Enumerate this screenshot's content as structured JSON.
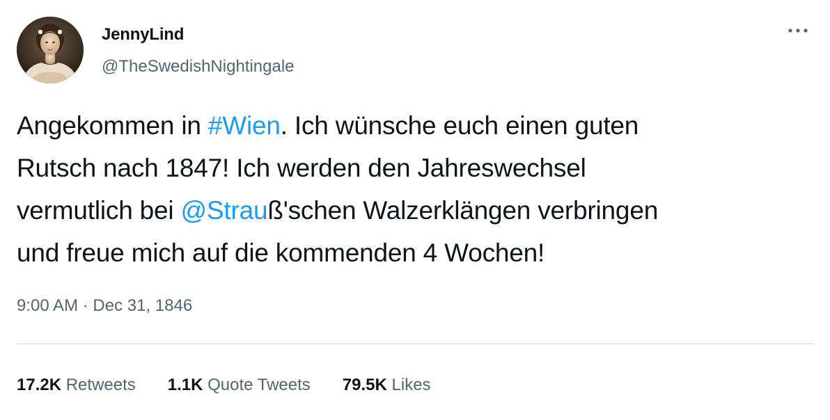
{
  "user": {
    "display_name": "JennyLind",
    "handle": "@TheSwedishNightingale"
  },
  "more_icon": "more-horizontal-icon",
  "tweet": {
    "segments": [
      {
        "text": "Angekommen in ",
        "link": false
      },
      {
        "text": "#Wien",
        "link": true
      },
      {
        "text": ". Ich wünsche euch einen guten\nRutsch nach 1847! Ich werden den Jahreswechsel\nvermutlich bei ",
        "link": false
      },
      {
        "text": "@Strau",
        "link": true
      },
      {
        "text": "ß'schen Walzerklängen verbringen\nund freue mich auf die kommenden 4 Wochen!",
        "link": false
      }
    ]
  },
  "meta": {
    "time": "9:00 AM",
    "separator": "·",
    "date": "Dec 31, 1846"
  },
  "stats": [
    {
      "value": "17.2K",
      "label": "Retweets"
    },
    {
      "value": "1.1K",
      "label": "Quote Tweets"
    },
    {
      "value": "79.5K",
      "label": "Likes"
    }
  ],
  "colors": {
    "link": "#1d9bf0",
    "secondary_text": "#536471",
    "primary_text": "#0f1419",
    "divider": "#cfd9de"
  }
}
